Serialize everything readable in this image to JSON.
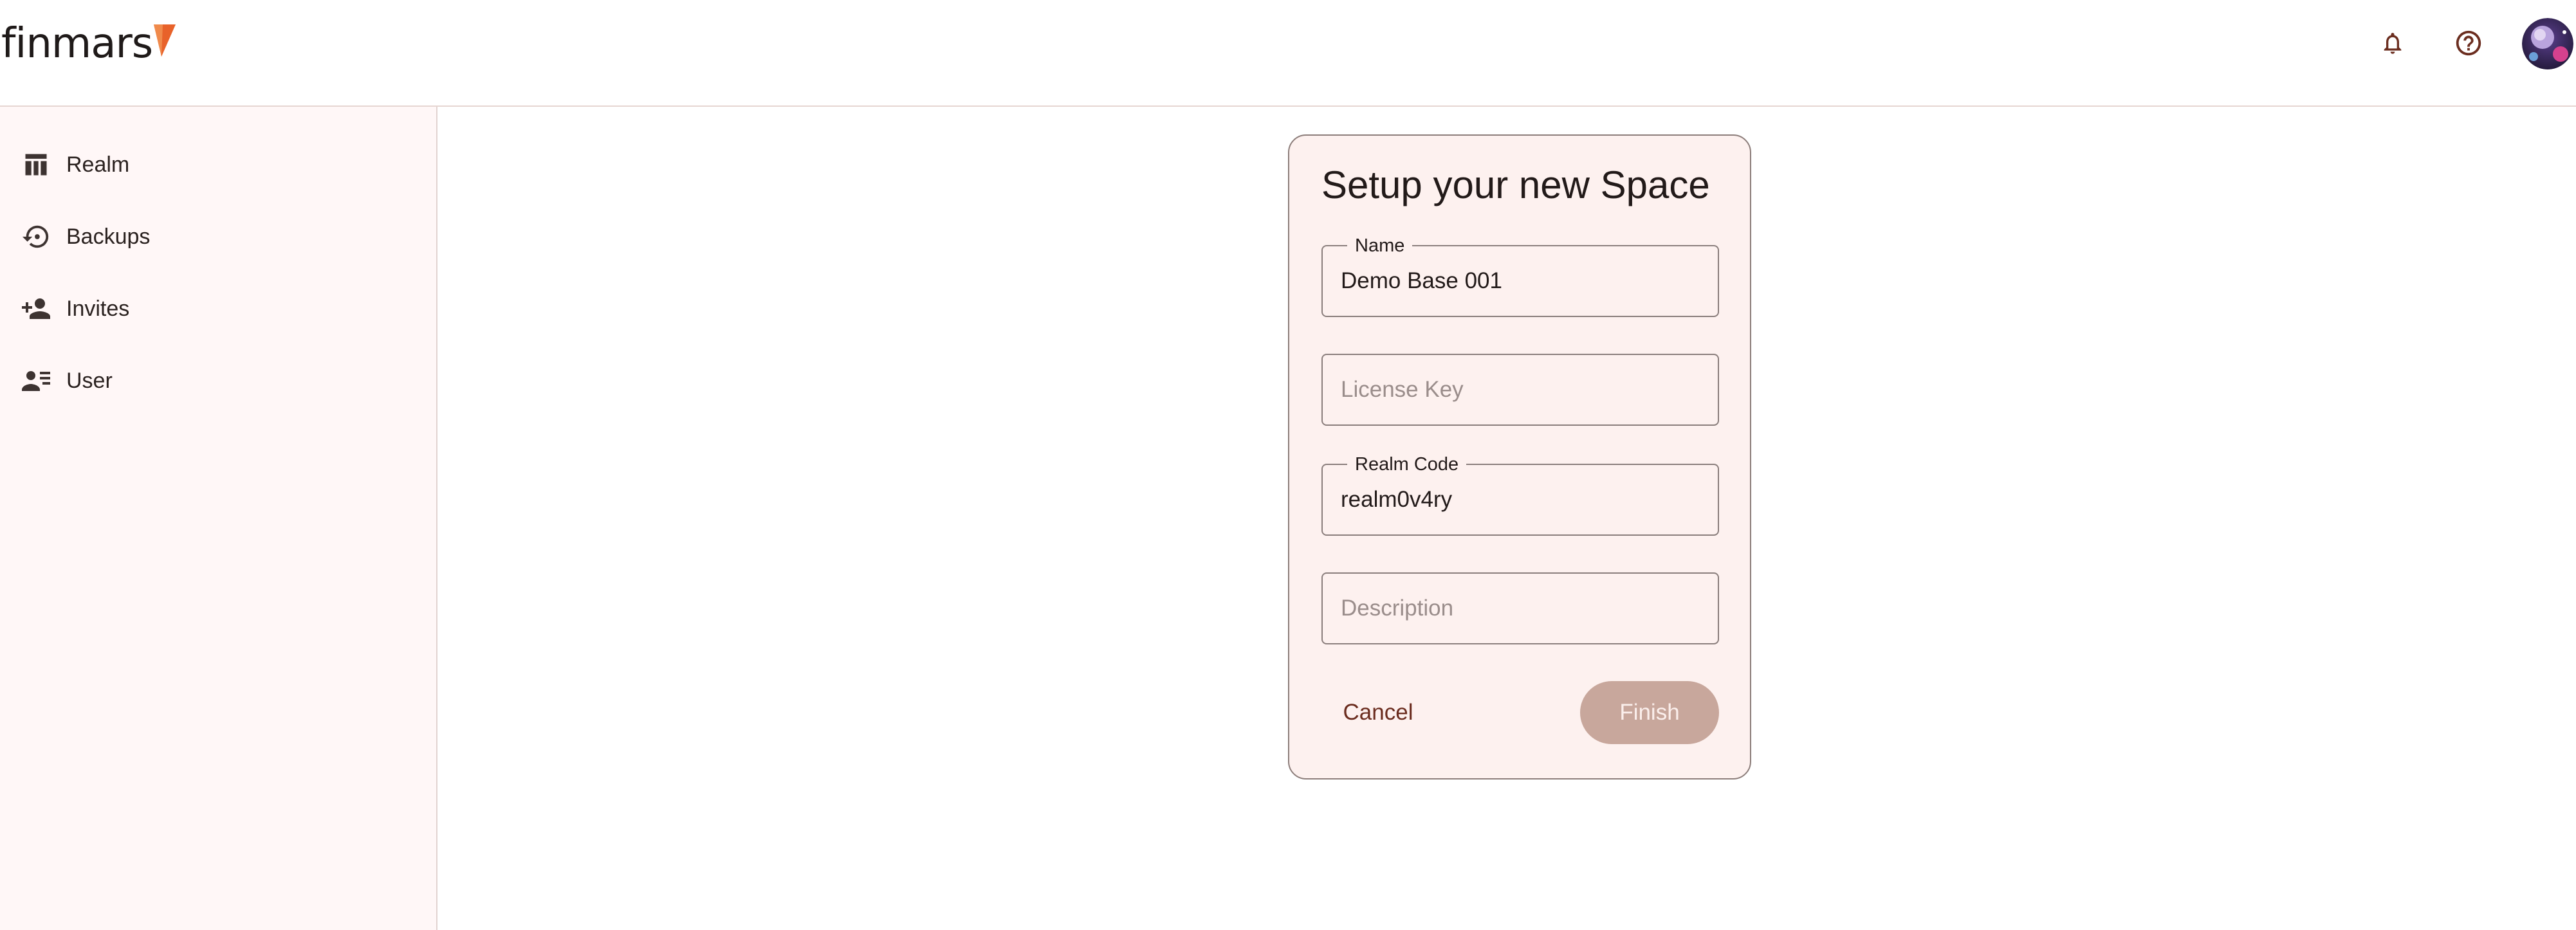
{
  "app": {
    "logo_text": "finmars",
    "brand_color": "#e8622a"
  },
  "header": {
    "notifications_icon": "bell-icon",
    "help_icon": "help-circle-icon",
    "avatar_icon": "user-avatar"
  },
  "sidebar": {
    "items": [
      {
        "label": "Realm",
        "icon": "table-columns-icon"
      },
      {
        "label": "Backups",
        "icon": "history-icon"
      },
      {
        "label": "Invites",
        "icon": "person-add-icon"
      },
      {
        "label": "User",
        "icon": "person-list-icon"
      }
    ]
  },
  "dialog": {
    "title": "Setup your new Space",
    "fields": {
      "name": {
        "label": "Name",
        "value": "Demo Base 001"
      },
      "license_key": {
        "placeholder": "License Key",
        "value": ""
      },
      "realm_code": {
        "label": "Realm Code",
        "value": "realm0v4ry"
      },
      "description": {
        "placeholder": "Description",
        "value": ""
      }
    },
    "cancel_label": "Cancel",
    "finish_label": "Finish",
    "finish_enabled": false
  },
  "colors": {
    "sidebar_bg": "#fff7f7",
    "dialog_bg": "#fdf1ef",
    "icon_color": "#6b2d1f",
    "finish_disabled_bg": "#c8a79c"
  }
}
